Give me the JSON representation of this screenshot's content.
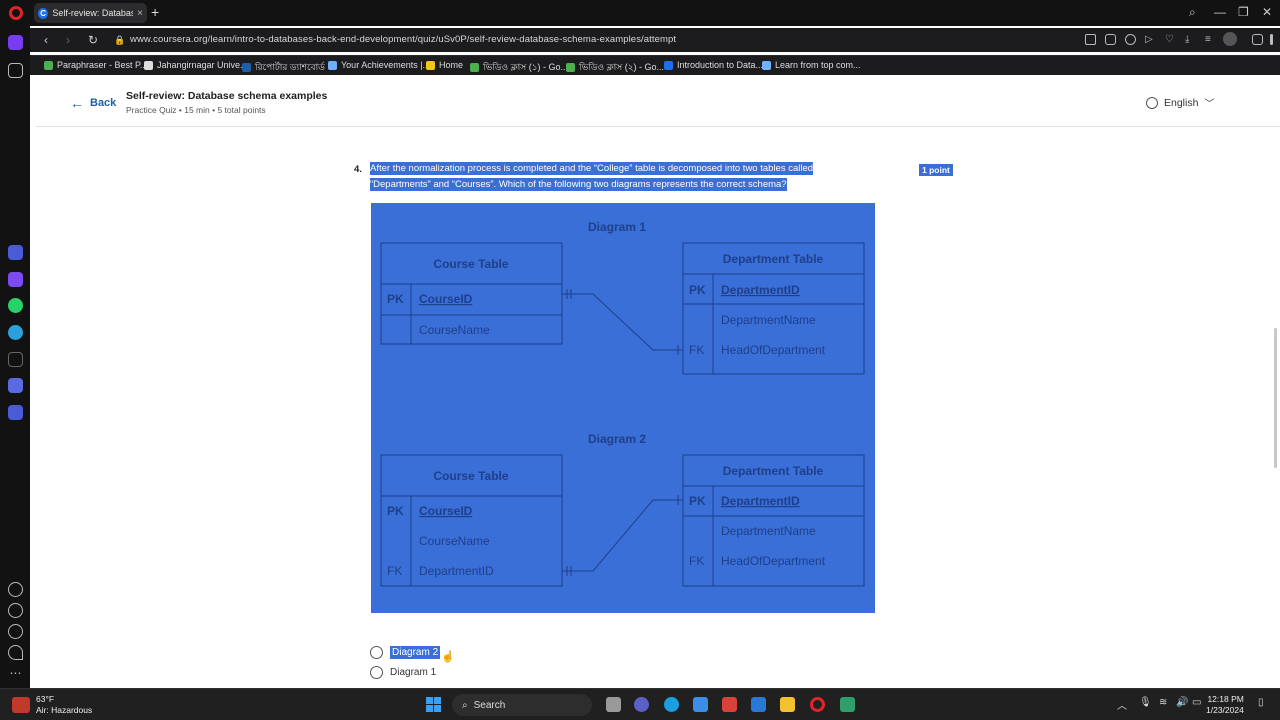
{
  "browser": {
    "tab_title": "Self-review: Database sche",
    "url": "www.coursera.org/learn/intro-to-databases-back-end-development/quiz/uSv0P/self-review-database-schema-examples/attempt"
  },
  "bookmarks": [
    {
      "label": "Paraphraser - Best P...",
      "color": "#4caf50"
    },
    {
      "label": "Jahangirnagar Unive...",
      "color": "#dddddd"
    },
    {
      "label": "রিপোর্টার ড্যাশবোর্ড",
      "color": "#1f5ea8"
    },
    {
      "label": "Your Achievements |...",
      "color": "#6fb1ff"
    },
    {
      "label": "Home",
      "color": "#f5c518"
    },
    {
      "label": "ভিডিও ক্লাস (১) - Go...",
      "color": "#4caf50"
    },
    {
      "label": "ভিডিও ক্লাস (২) - Go...",
      "color": "#4caf50"
    },
    {
      "label": "Introduction to Data...",
      "color": "#1f6feb"
    },
    {
      "label": "Learn from top com...",
      "color": "#6fb1ff"
    }
  ],
  "header": {
    "back_label": "Back",
    "quiz_title": "Self-review: Database schema examples",
    "quiz_meta": "Practice Quiz • 15 min • 5 total points",
    "language": "English"
  },
  "question": {
    "number": "4.",
    "text_line1": "After the normalization process is completed and the “College” table is decomposed into two tables called",
    "text_line2": "“Departments” and “Courses”. Which of the following two diagrams represents the correct schema?",
    "points": "1 point"
  },
  "diagrams": [
    {
      "title": "Diagram 1",
      "course_table": {
        "name": "Course Table",
        "rows": [
          {
            "key": "PK",
            "field": "CourseID"
          },
          {
            "key": "",
            "field": "CourseName"
          }
        ]
      },
      "department_table": {
        "name": "Department Table",
        "rows": [
          {
            "key": "PK",
            "field": "DepartmentID"
          },
          {
            "key": "",
            "field": "DepartmentName"
          },
          {
            "key": "FK",
            "field": "HeadOfDepartment"
          }
        ]
      }
    },
    {
      "title": "Diagram 2",
      "course_table": {
        "name": "Course Table",
        "rows": [
          {
            "key": "PK",
            "field": "CourseID"
          },
          {
            "key": "",
            "field": "CourseName"
          },
          {
            "key": "FK",
            "field": "DepartmentID"
          }
        ]
      },
      "department_table": {
        "name": "Department Table",
        "rows": [
          {
            "key": "PK",
            "field": "DepartmentID"
          },
          {
            "key": "",
            "field": "DepartmentName"
          },
          {
            "key": "FK",
            "field": "HeadOfDepartment"
          }
        ]
      }
    }
  ],
  "options": [
    {
      "label": "Diagram 2",
      "selected_highlight": true
    },
    {
      "label": "Diagram 1",
      "selected_highlight": false
    }
  ],
  "taskbar": {
    "temperature": "63°F",
    "weather": "Air: Hazardous",
    "search": "Search",
    "time": "12:18 PM",
    "date": "1/23/2024"
  },
  "colors": {
    "highlight": "#3a6fd8",
    "link": "#1f5ea8"
  }
}
